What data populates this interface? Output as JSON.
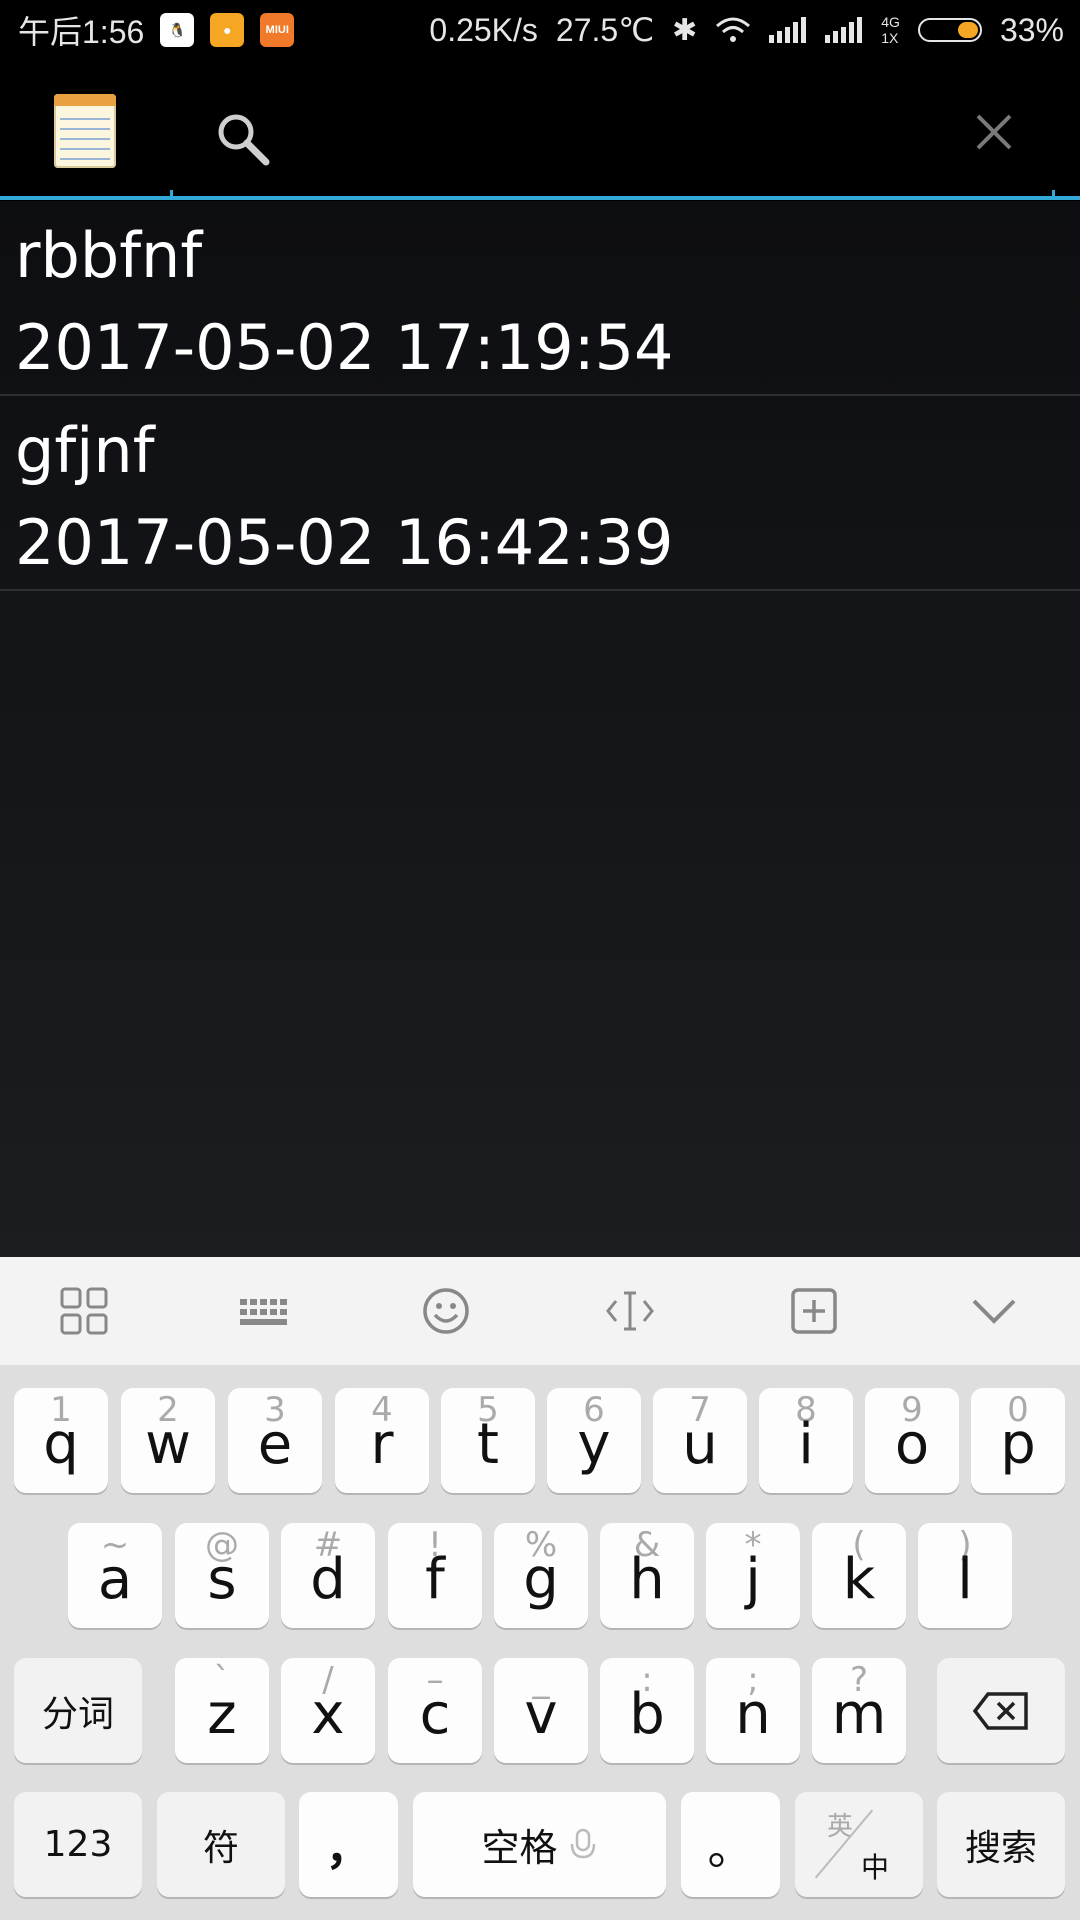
{
  "status_bar": {
    "time": "午后1:56",
    "network_speed": "0.25K/s",
    "temperature": "27.5℃",
    "network_type_top": "4G",
    "network_type_bottom": "1X",
    "battery": "33%",
    "battery_level_percent": 33,
    "notification_icons": [
      "qq-icon",
      "message-icon",
      "miui-icon"
    ],
    "miui_label": "MIUI"
  },
  "action_bar": {
    "search_placeholder": "",
    "search_value": "",
    "accent_color": "#33a9d8"
  },
  "notes": [
    {
      "title": "rbbfnf",
      "timestamp": "2017-05-02 17:19:54"
    },
    {
      "title": "gfjnf",
      "timestamp": "2017-05-02 16:42:39"
    }
  ],
  "keyboard": {
    "toolbar_icons": [
      "grid-icon",
      "keyboard-icon",
      "emoji-icon",
      "cursor-icon",
      "add-icon",
      "collapse-icon"
    ],
    "row1": [
      {
        "main": "q",
        "sub": "1"
      },
      {
        "main": "w",
        "sub": "2"
      },
      {
        "main": "e",
        "sub": "3"
      },
      {
        "main": "r",
        "sub": "4"
      },
      {
        "main": "t",
        "sub": "5"
      },
      {
        "main": "y",
        "sub": "6"
      },
      {
        "main": "u",
        "sub": "7"
      },
      {
        "main": "i",
        "sub": "8"
      },
      {
        "main": "o",
        "sub": "9"
      },
      {
        "main": "p",
        "sub": "0"
      }
    ],
    "row2": [
      {
        "main": "a",
        "sub": "~"
      },
      {
        "main": "s",
        "sub": "@"
      },
      {
        "main": "d",
        "sub": "#"
      },
      {
        "main": "f",
        "sub": "!"
      },
      {
        "main": "g",
        "sub": "%"
      },
      {
        "main": "h",
        "sub": "&"
      },
      {
        "main": "j",
        "sub": "*"
      },
      {
        "main": "k",
        "sub": "("
      },
      {
        "main": "l",
        "sub": ")"
      }
    ],
    "row3": [
      {
        "main": "z",
        "sub": "`"
      },
      {
        "main": "x",
        "sub": "/"
      },
      {
        "main": "c",
        "sub": "–"
      },
      {
        "main": "v",
        "sub": "_"
      },
      {
        "main": "b",
        "sub": ":"
      },
      {
        "main": "n",
        "sub": ";"
      },
      {
        "main": "m",
        "sub": "?"
      }
    ],
    "segment_label": "分词",
    "numbers_label": "123",
    "symbols_label": "符",
    "comma_label": "，",
    "space_label": "空格",
    "period_label": "。",
    "lang_top": "英",
    "lang_bottom": "中",
    "search_label": "搜索"
  }
}
